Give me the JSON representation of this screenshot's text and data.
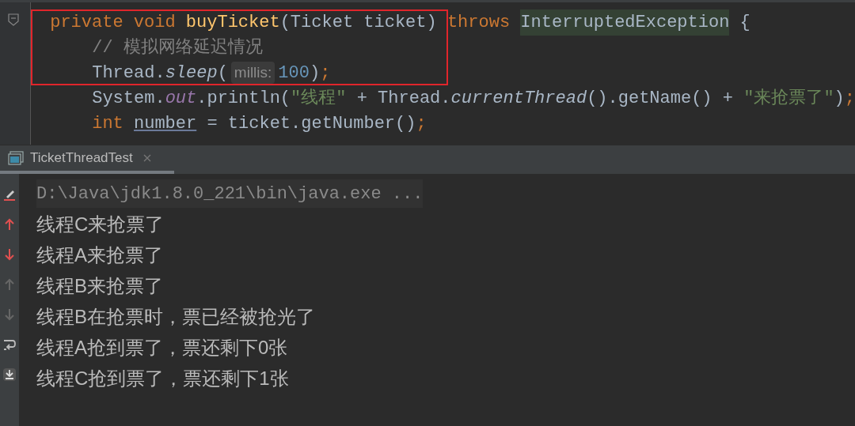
{
  "editor": {
    "lines": [
      {
        "boxed": true,
        "tokens": [
          {
            "kind": "keyword",
            "text": "private void "
          },
          {
            "kind": "decl",
            "text": "buyTicket"
          },
          {
            "kind": "plain",
            "text": "(Ticket ticket) "
          },
          {
            "kind": "keyword",
            "text": "throws "
          },
          {
            "kind": "highlight",
            "text": "InterruptedException"
          },
          {
            "kind": "plain",
            "text": " {"
          }
        ],
        "children": [
          {
            "boxed": true,
            "tokens": [
              {
                "kind": "comment",
                "text": "// 模拟网络延迟情况"
              }
            ]
          },
          {
            "boxed": true,
            "tokens": [
              {
                "kind": "plain",
                "text": "Thread."
              },
              {
                "kind": "italic",
                "text": "sleep"
              },
              {
                "kind": "plain",
                "text": "("
              },
              {
                "kind": "hint",
                "text": "millis:"
              },
              {
                "kind": "number",
                "text": "100"
              },
              {
                "kind": "plain",
                "text": ")"
              },
              {
                "kind": "keyword",
                "text": ";"
              }
            ]
          },
          {
            "boxed": false,
            "tokens": [
              {
                "kind": "plain",
                "text": "System."
              },
              {
                "kind": "field",
                "text": "out"
              },
              {
                "kind": "plain",
                "text": ".println("
              },
              {
                "kind": "string",
                "text": "\"线程\""
              },
              {
                "kind": "plain",
                "text": " + Thread."
              },
              {
                "kind": "italic",
                "text": "currentThread"
              },
              {
                "kind": "plain",
                "text": "().getName() + "
              },
              {
                "kind": "string",
                "text": "\"来抢票了\""
              },
              {
                "kind": "plain",
                "text": ")"
              },
              {
                "kind": "keyword",
                "text": ";"
              }
            ]
          },
          {
            "boxed": false,
            "tokens": [
              {
                "kind": "keyword",
                "text": "int "
              },
              {
                "kind": "local",
                "text": "number"
              },
              {
                "kind": "plain",
                "text": " = ticket.getNumber()"
              },
              {
                "kind": "keyword",
                "text": ";"
              }
            ]
          }
        ]
      }
    ]
  },
  "run_panel": {
    "tab": {
      "label": "TicketThreadTest",
      "selected": true
    },
    "command": "D:\\Java\\jdk1.8.0_221\\bin\\java.exe ...",
    "output": [
      "线程C来抢票了",
      "线程A来抢票了",
      "线程B来抢票了",
      "线程B在抢票时，票已经被抢光了",
      "线程A抢到票了，票还剩下0张",
      "线程C抢到票了，票还剩下1张"
    ]
  }
}
